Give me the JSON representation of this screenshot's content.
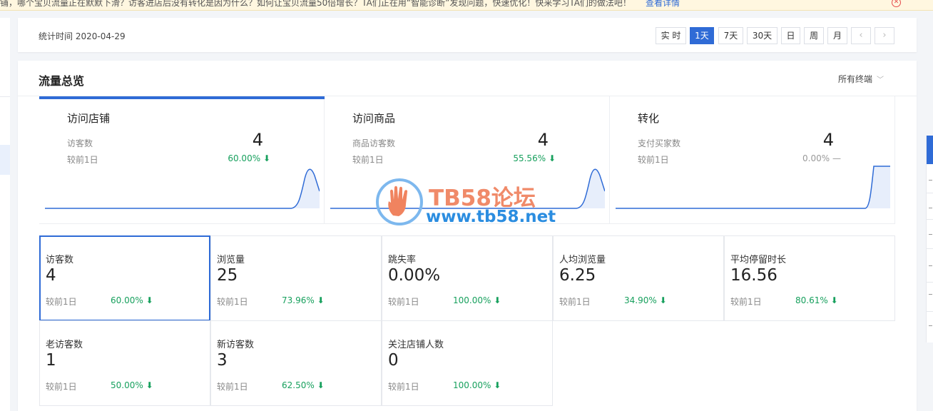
{
  "banner": {
    "text": "铺，哪个宝贝流量正在默默下滑？访客进店后没有转化是因为什么？如何让宝贝流量50倍增长？TA们正在用“智能诊断”发现问题，快速优化！快来学习TA们的做法吧！",
    "link": "查看详情",
    "close_icon": "close-circle-icon"
  },
  "header": {
    "stat_time_label": "统计时间",
    "stat_time_value": "2020-04-29",
    "segments": [
      "实 时",
      "1天",
      "7天",
      "30天",
      "日",
      "周",
      "月"
    ],
    "active_segment": "1天",
    "prev_label": "‹",
    "next_label": "›"
  },
  "main": {
    "title": "流量总览",
    "terminal": "所有终端"
  },
  "overview": [
    {
      "title": "访问店铺",
      "metric": "访客数",
      "value": "4",
      "compare": "较前1日",
      "pct": "60.00%",
      "trend": "down"
    },
    {
      "title": "访问商品",
      "metric": "商品访客数",
      "value": "4",
      "compare": "较前1日",
      "pct": "55.56%",
      "trend": "down"
    },
    {
      "title": "转化",
      "metric": "支付买家数",
      "value": "4",
      "compare": "较前1日",
      "pct": "0.00%",
      "trend": "flat"
    }
  ],
  "metrics": [
    {
      "label": "访客数",
      "value": "4",
      "compare": "较前1日",
      "pct": "60.00%"
    },
    {
      "label": "浏览量",
      "value": "25",
      "compare": "较前1日",
      "pct": "73.96%"
    },
    {
      "label": "跳失率",
      "value": "0.00%",
      "compare": "较前1日",
      "pct": "100.00%"
    },
    {
      "label": "人均浏览量",
      "value": "6.25",
      "compare": "较前1日",
      "pct": "34.90%"
    },
    {
      "label": "平均停留时长",
      "value": "16.56",
      "compare": "较前1日",
      "pct": "80.61%"
    },
    {
      "label": "老访客数",
      "value": "1",
      "compare": "较前1日",
      "pct": "50.00%"
    },
    {
      "label": "新访客数",
      "value": "3",
      "compare": "较前1日",
      "pct": "62.50%"
    },
    {
      "label": "关注店铺人数",
      "value": "0",
      "compare": "较前1日",
      "pct": "100.00%"
    }
  ],
  "down_arrow": "⬇",
  "flat_mark": "—",
  "watermark": {
    "title": "TB58论坛",
    "url": "www.tb58.net"
  },
  "colors": {
    "accent": "#2f6bd6",
    "down": "#17a05d",
    "watermark_title": "#f08a69",
    "watermark_url": "#2b8de0"
  }
}
